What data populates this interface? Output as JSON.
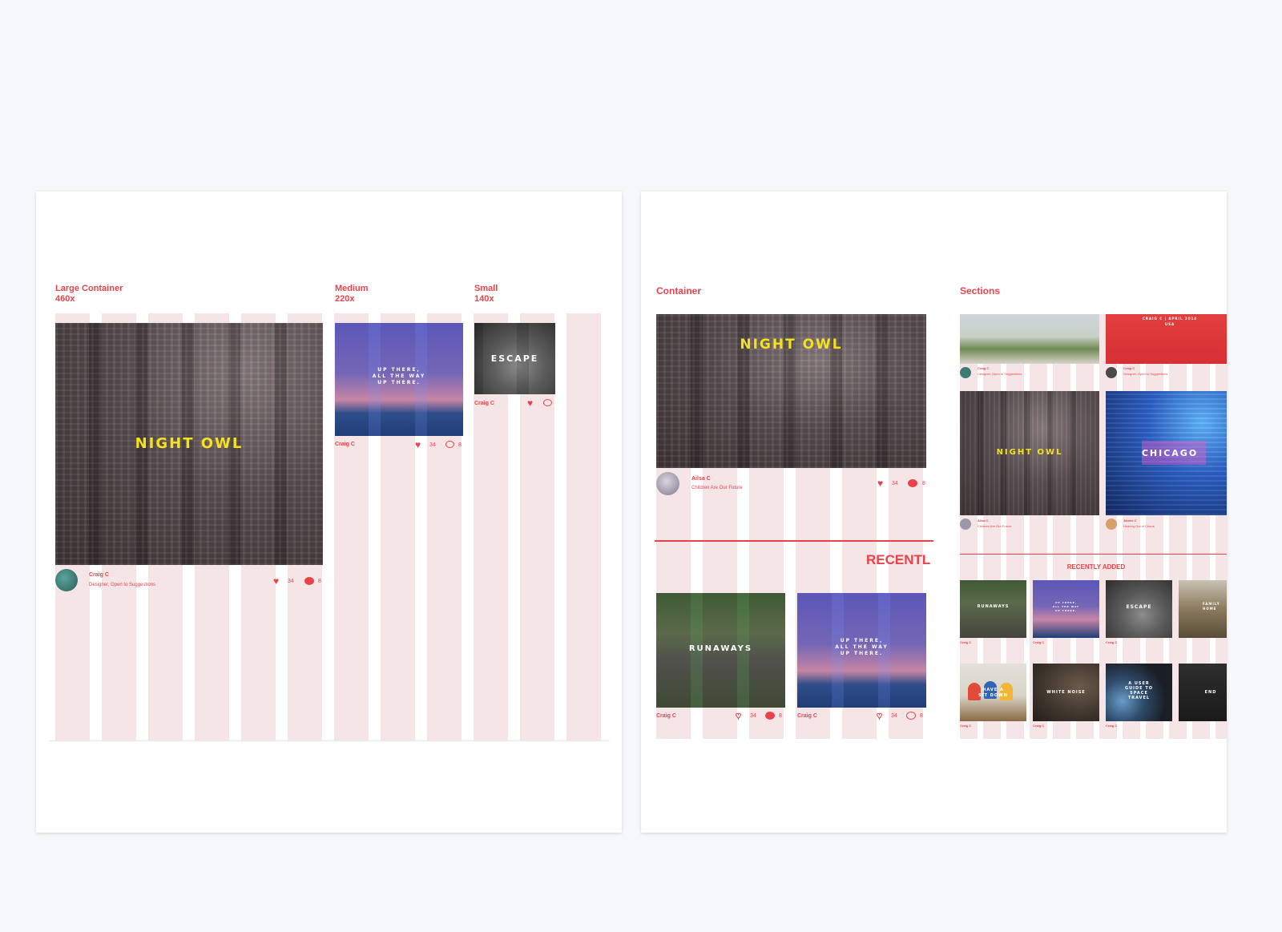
{
  "left_board": {
    "large": {
      "label_title": "Large Container",
      "label_size": "460x",
      "title": "NIGHT OWL",
      "author": "Craig C",
      "subtitle": "Designer, Open to Suggestions",
      "likes": "34",
      "comments": "8"
    },
    "medium": {
      "label_title": "Medium",
      "label_size": "220x",
      "title": "UP THERE,\nALL THE WAY\nUP THERE.",
      "author": "Craig C",
      "likes": "34",
      "comments": "8"
    },
    "small": {
      "label_title": "Small",
      "label_size": "140x",
      "title": "ESCAPE",
      "author": "Craig C"
    }
  },
  "right_board": {
    "container": {
      "label": "Container",
      "hero": {
        "title": "NIGHT OWL",
        "author": "Ailsa C",
        "subtitle": "Children Are Our Future",
        "likes": "34",
        "comments": "8"
      },
      "recent_heading": "RECENTL",
      "cards": [
        {
          "title": "RUNAWAYS",
          "author": "Craig C",
          "likes": "34",
          "comments": "8"
        },
        {
          "title": "UP THERE,\nALL THE WAY\nUP THERE.",
          "author": "Craig C",
          "likes": "34",
          "comments": "8"
        }
      ]
    },
    "sections": {
      "label": "Sections",
      "top_tiles": [
        {
          "title": "",
          "author": "Craig C",
          "subtitle": "Designer, Open to Suggestions"
        },
        {
          "title": "CRAIG C | APRIL 2014\nUSA",
          "author": "Craig C",
          "subtitle": "Designer, Open to Suggestions"
        }
      ],
      "mid_tiles": [
        {
          "title": "NIGHT OWL",
          "author": "Ailsa C",
          "subtitle": "Children Are Our Future"
        },
        {
          "title": "CHICAGO",
          "author": "James C",
          "subtitle": "Hearing Out of Chaos"
        }
      ],
      "recent_heading": "RECENTLY ADDED",
      "grid": [
        {
          "title": "RUNAWAYS",
          "author": "Craig C"
        },
        {
          "title": "UP THERE,\nALL THE WAY\nUP THERE.",
          "author": "Craig C"
        },
        {
          "title": "ESCAPE",
          "author": "Craig C"
        },
        {
          "title": "FAMILY\nHOME",
          "author": ""
        },
        {
          "title": "HAVE A\nSIT DOWN",
          "author": "Craig C"
        },
        {
          "title": "WHITE NOISE",
          "author": "Craig C"
        },
        {
          "title": "A USER\nGUIDE TO\nSPACE\nTRAVEL",
          "author": "Craig C"
        },
        {
          "title": "END",
          "author": ""
        }
      ]
    }
  },
  "colors": {
    "accent": "#e8434a",
    "grid_column": "#f6e5e7",
    "title_yellow": "#f6e21a",
    "background": "#f7f8fb"
  },
  "icons": [
    "heart-icon",
    "comment-icon",
    "avatar"
  ]
}
